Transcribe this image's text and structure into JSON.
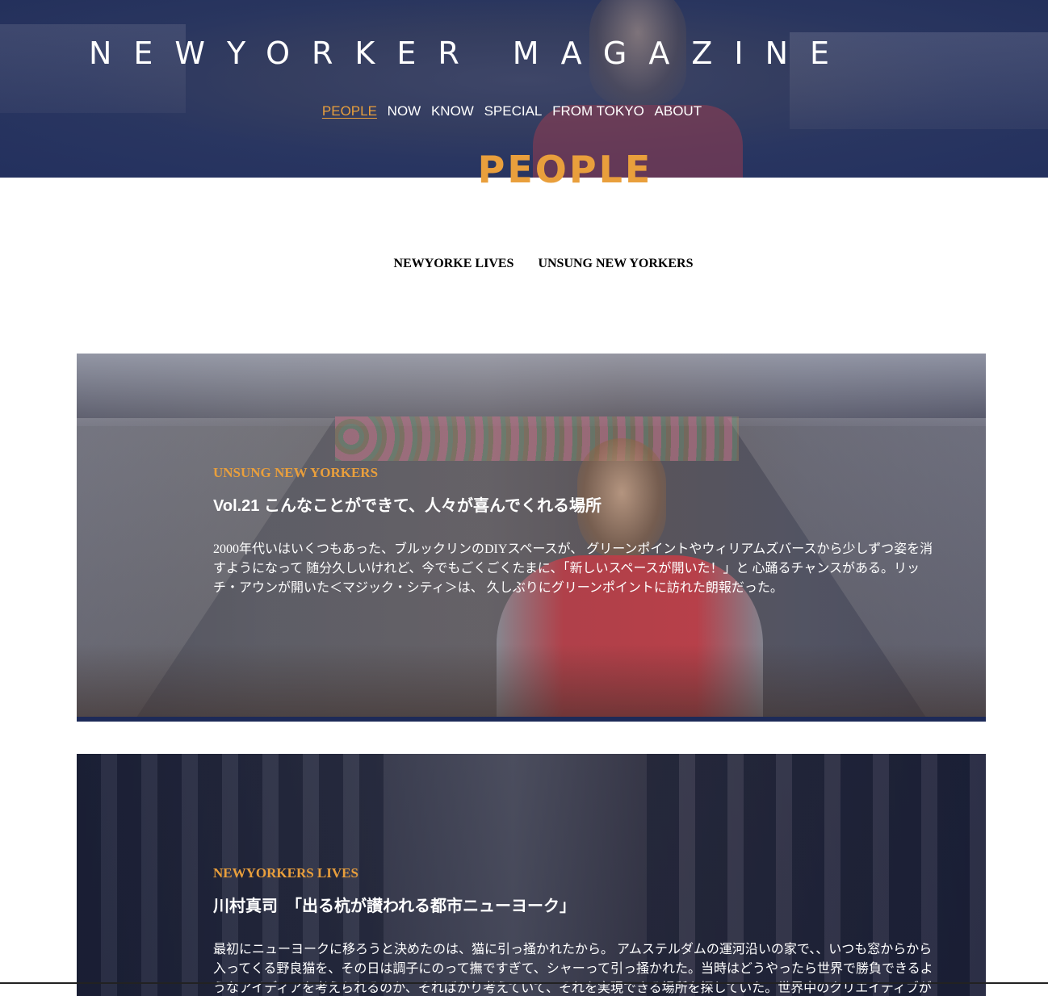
{
  "header": {
    "site_title": "NEWYORKER MAGAZINE",
    "nav": [
      {
        "label": "PEOPLE",
        "active": true
      },
      {
        "label": "NOW",
        "active": false
      },
      {
        "label": "KNOW",
        "active": false
      },
      {
        "label": "SPECIAL",
        "active": false
      },
      {
        "label": "FROM TOKYO",
        "active": false
      },
      {
        "label": "ABOUT",
        "active": false
      }
    ],
    "section_title": "PEOPLE"
  },
  "subnav": {
    "items": [
      {
        "label": "NEWYORKE LIVES"
      },
      {
        "label": "UNSUNG NEW YORKERS"
      }
    ]
  },
  "articles": [
    {
      "category": "UNSUNG NEW YORKERS",
      "title": "Vol.21 こんなことができて、人々が喜んでくれる場所",
      "excerpt": "2000年代いはいくつもあった、ブルックリンのDIYスペースが、 グリーンポイントやウィリアムズバースから少しずつ姿を消すようになって 随分久しいけれど、今でもごくごくたまに、「新しいスペースが開いた！」と 心踊るチャンスがある。リッチ・アウンが開いた＜マジック・シティ＞は、 久しぶりにグリーンポイントに訪れた朗報だった。"
    },
    {
      "category": "NEWYORKERS LIVES",
      "title": "川村真司　「出る杭が讃われる都市ニューヨーク」",
      "excerpt": "最初にニューヨークに移ろうと決めたのは、猫に引っ掻かれたから。 アムステルダムの運河沿いの家で、、いつも窓からから入ってくる野良猫を、その日は調子にのって撫ですぎて、シャーって引っ掻かれた。当時はどうやったら世界で勝負できるようなアイディアを考えられるのか、そればかり考えていて、それを実現できる場所を探していた。世界中のクリエイティブがぶつかり合う"
    }
  ],
  "colors": {
    "accent": "#e99f3c",
    "header_overlay": "#233262",
    "text_light": "#ffffff",
    "text_dark": "#000000"
  }
}
